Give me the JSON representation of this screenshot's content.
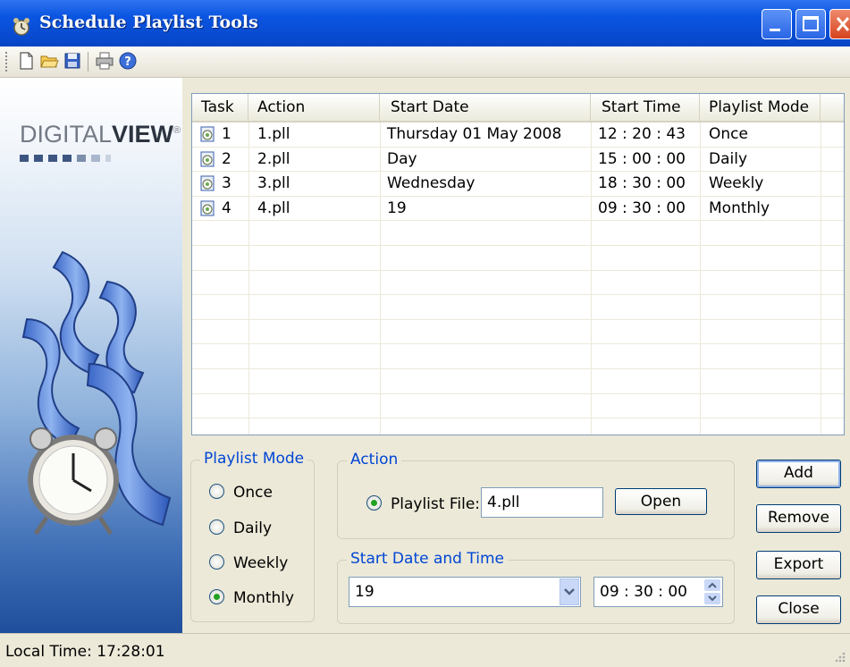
{
  "window": {
    "title": "Schedule Playlist Tools"
  },
  "toolbar": {
    "icons": [
      "new-file-icon",
      "open-folder-icon",
      "save-icon",
      "print-icon",
      "help-icon"
    ]
  },
  "logo": {
    "brand_light": "DIGITAL",
    "brand_bold": "VIEW",
    "mark": "®"
  },
  "table": {
    "columns": [
      "Task",
      "Action",
      "Start Date",
      "Start Time",
      "Playlist Mode"
    ],
    "rows": [
      {
        "task": "1",
        "action": "1.pll",
        "start_date": "Thursday 01 May 2008",
        "start_time": "12 : 20 : 43",
        "mode": "Once"
      },
      {
        "task": "2",
        "action": "2.pll",
        "start_date": "Day",
        "start_time": "15 : 00 : 00",
        "mode": "Daily"
      },
      {
        "task": "3",
        "action": "3.pll",
        "start_date": "Wednesday",
        "start_time": "18 : 30 : 00",
        "mode": "Weekly"
      },
      {
        "task": "4",
        "action": "4.pll",
        "start_date": "19",
        "start_time": "09 : 30 : 00",
        "mode": "Monthly"
      }
    ]
  },
  "playlist_mode": {
    "title": "Playlist Mode",
    "options": [
      "Once",
      "Daily",
      "Weekly",
      "Monthly"
    ],
    "selected": "Monthly"
  },
  "action": {
    "title": "Action",
    "playlist_file_label": "Playlist File:",
    "playlist_file_value": "4.pll",
    "open_label": "Open"
  },
  "start_datetime": {
    "title": "Start Date and Time",
    "date_value": "19",
    "time_value": "09 : 30 : 00"
  },
  "buttons": {
    "add": "Add",
    "remove": "Remove",
    "export": "Export",
    "close": "Close"
  },
  "status": {
    "local_time": "Local Time: 17:28:01"
  },
  "colors": {
    "title_bar": "#0a55e2",
    "group_title": "#0046d5",
    "radio_selected": "#21a121"
  }
}
